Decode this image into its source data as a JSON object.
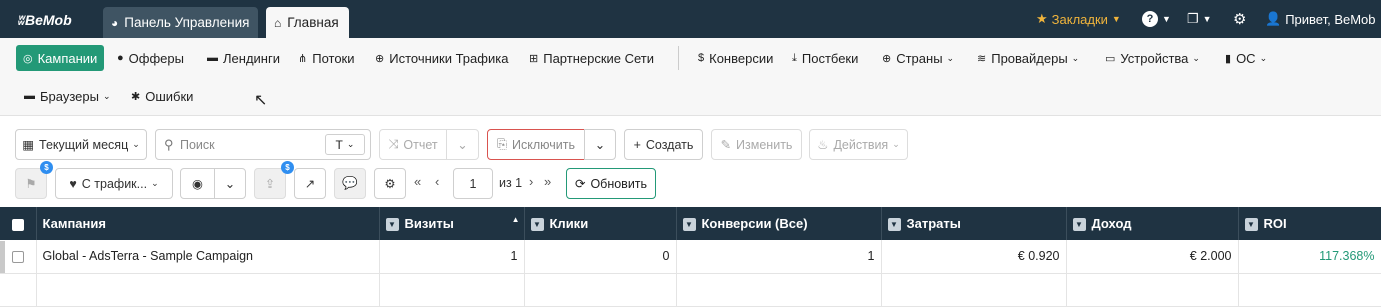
{
  "brand": "BeMob",
  "tabs": [
    {
      "label": "Панель Управления"
    },
    {
      "label": "Главная"
    }
  ],
  "topbar": {
    "bookmarks_label": "Закладки",
    "help_label": "?",
    "user_label": "Привет, BeMob"
  },
  "nav": {
    "items": [
      {
        "label": "Кампании",
        "icon": "bullseye-icon"
      },
      {
        "label": "Офферы",
        "icon": "dollar-circle-icon"
      },
      {
        "label": "Лендинги",
        "icon": "window-icon"
      },
      {
        "label": "Потоки",
        "icon": "sitemap-icon"
      },
      {
        "label": "Источники Трафика",
        "icon": "globe-icon"
      },
      {
        "label": "Партнерские Сети",
        "icon": "network-icon"
      },
      {
        "label": "Конверсии",
        "icon": "dollar-icon"
      },
      {
        "label": "Постбеки",
        "icon": "download-icon"
      },
      {
        "label": "Страны",
        "icon": "globe-icon"
      },
      {
        "label": "Провайдеры",
        "icon": "wifi-icon"
      },
      {
        "label": "Устройства",
        "icon": "laptop-icon"
      },
      {
        "label": "ОС",
        "icon": "mobile-icon"
      },
      {
        "label": "Браузеры",
        "icon": "browser-icon"
      },
      {
        "label": "Ошибки",
        "icon": "bug-icon"
      }
    ]
  },
  "toolbar": {
    "period_label": "Текущий месяц",
    "search_placeholder": "Поиск",
    "search_value": "",
    "search_mode": "T",
    "report_label": "Отчет",
    "exclude_label": "Исключить",
    "create_label": "Создать",
    "edit_label": "Изменить",
    "actions_label": "Действия",
    "traffic_filter_label": "С трафик...",
    "page_current": "1",
    "page_of": "из 1",
    "refresh_label": "Обновить",
    "badge_value": "$"
  },
  "table": {
    "columns": [
      "Кампания",
      "Визиты",
      "Клики",
      "Конверсии (Все)",
      "Затраты",
      "Доход",
      "ROI"
    ],
    "rows": [
      {
        "campaign": "Global - AdsTerra - Sample Campaign",
        "visits": "1",
        "clicks": "0",
        "conversions": "1",
        "cost": "€ 0.920",
        "revenue": "€ 2.000",
        "roi": "117.368%"
      }
    ]
  },
  "colors": {
    "header_bg": "#1f3342",
    "accent": "#239977",
    "bookmark": "#f0b43c",
    "badge": "#2f8ef0"
  }
}
